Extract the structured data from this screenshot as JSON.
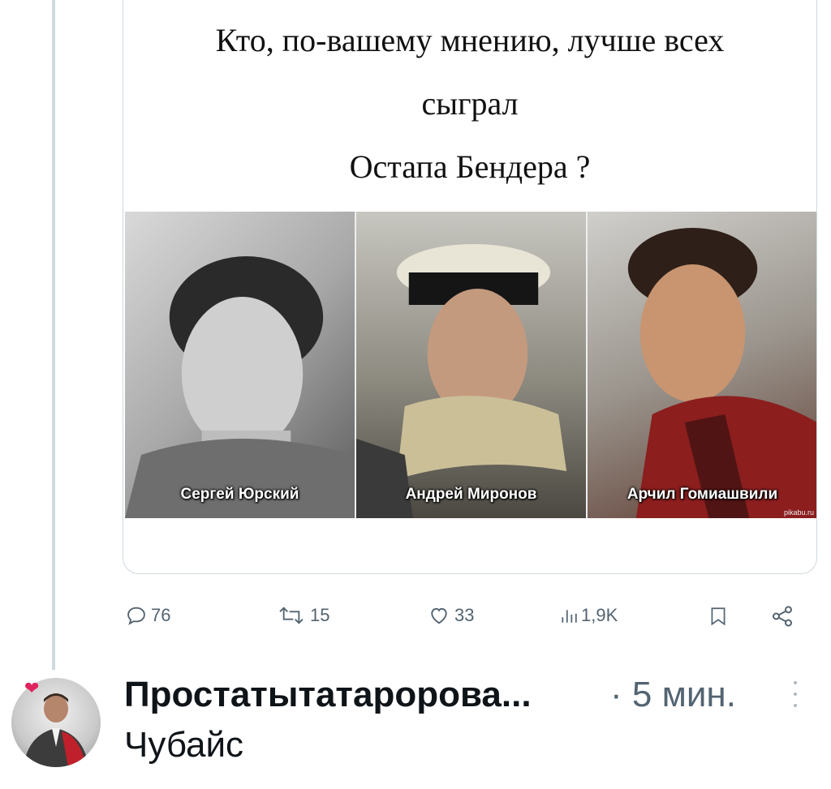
{
  "post": {
    "question_lines": [
      "Кто, по-вашему мнению, лучше всех",
      "сыграл",
      "Остапа Бендера ?"
    ],
    "photos": [
      {
        "caption": "Сергей Юрский"
      },
      {
        "caption": "Андрей Миронов"
      },
      {
        "caption": "Арчил Гомиашвили"
      }
    ],
    "watermark": "pikabu.ru"
  },
  "actions": {
    "replies": "76",
    "reposts": "15",
    "likes": "33",
    "views": "1,9K"
  },
  "reply": {
    "author": "Простатытатаророва...",
    "time": "· 5 мин.",
    "text": "Чубайс"
  },
  "colors": {
    "muted": "#536471",
    "thread_line": "#cfd9de"
  }
}
